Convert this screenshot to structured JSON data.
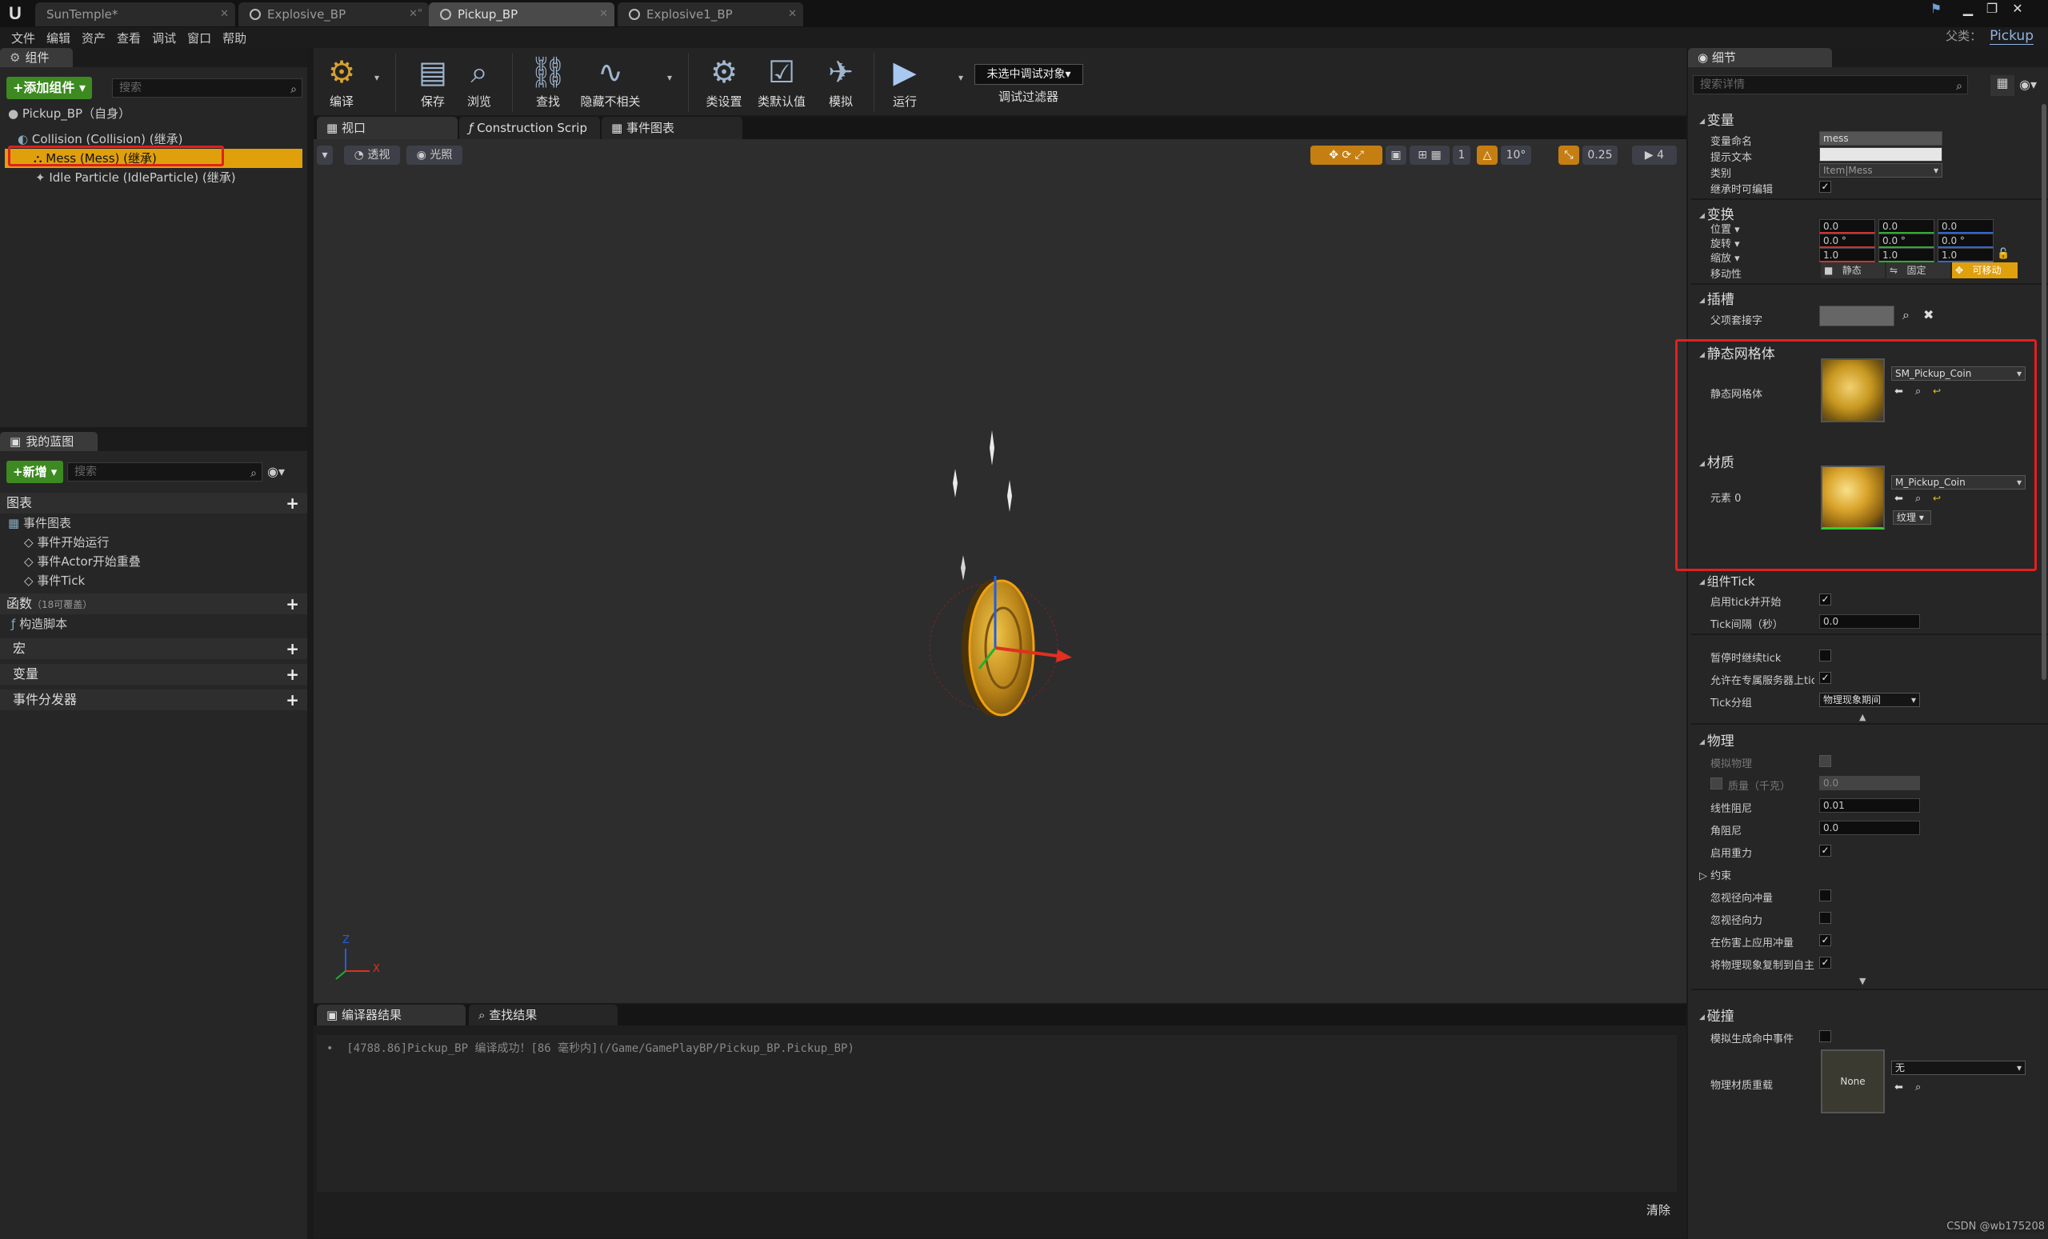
{
  "tabs": [
    {
      "label": "SunTemple*"
    },
    {
      "label": "Explosive_BP"
    },
    {
      "label": "Pickup_BP"
    },
    {
      "label": "Explosive1_BP"
    }
  ],
  "menu": [
    "文件",
    "编辑",
    "资产",
    "查看",
    "调试",
    "窗口",
    "帮助"
  ],
  "parent": {
    "label": "父类：",
    "value": "Pickup"
  },
  "components": {
    "tab": "组件",
    "add_button": "+添加组件 ▾",
    "search_placeholder": "搜索",
    "root": "Pickup_BP（自身）",
    "items": [
      "Collision (Collision) (继承)",
      "Mess (Mess) (继承)",
      "Idle Particle (IdleParticle) (继承)"
    ]
  },
  "myblueprint": {
    "tab": "我的蓝图",
    "new_button": "+新增 ▾",
    "search_placeholder": "搜索",
    "graphs": "图表",
    "event_graph": "事件图表",
    "events": [
      "事件开始运行",
      "事件Actor开始重叠",
      "事件Tick"
    ],
    "functions": "函数",
    "functions_count": "（18可覆盖）",
    "construction": "构造脚本",
    "macros": "宏",
    "variables": "变量",
    "dispatchers": "事件分发器"
  },
  "toolbar": {
    "compile": "编译",
    "save": "保存",
    "browse": "浏览",
    "find": "查找",
    "hide": "隐藏不相关",
    "class_settings": "类设置",
    "class_defaults": "类默认值",
    "simulate": "模拟",
    "play": "运行",
    "debug_object": "未选中调试对象▾",
    "debug_filter": "调试过滤器"
  },
  "viewtabs": [
    "视口",
    "Construction Scrip",
    "事件图表"
  ],
  "viewport": {
    "perspective": "透视",
    "lit": "光照",
    "angle": "10°",
    "scale": "0.25",
    "speed": "4",
    "axis_x": "X",
    "axis_z": "Z"
  },
  "bottom": {
    "tab1": "编译器结果",
    "tab2": "查找结果",
    "log": "[4788.86]Pickup_BP 编译成功！[86 毫秒内](/Game/GamePlayBP/Pickup_BP.Pickup_BP)",
    "clear": "清除"
  },
  "details": {
    "tab": "细节",
    "search_placeholder": "搜索详情",
    "variable": {
      "title": "变量",
      "name_label": "变量命名",
      "name_value": "mess",
      "tooltip_label": "提示文本",
      "category_label": "类别",
      "category_value": "Item|Mess",
      "editable_label": "继承时可编辑"
    },
    "transform": {
      "title": "变换",
      "location": "位置 ▾",
      "rotation": "旋转 ▾",
      "scale": "缩放 ▾",
      "mobility": "移动性",
      "loc": [
        "0.0",
        "0.0",
        "0.0"
      ],
      "rot": [
        "0.0 °",
        "0.0 °",
        "0.0 °"
      ],
      "scl": [
        "1.0",
        "1.0",
        "1.0"
      ],
      "static": "静态",
      "stationary": "固定",
      "movable": "可移动"
    },
    "sockets": {
      "title": "插槽",
      "parent_socket": "父项套接字"
    },
    "static_mesh": {
      "title": "静态网格体",
      "label": "静态网格体",
      "value": "SM_Pickup_Coin"
    },
    "materials": {
      "title": "材质",
      "label": "元素 0",
      "value": "M_Pickup_Coin",
      "texture": "纹理 ▾"
    },
    "tick": {
      "title": "组件Tick",
      "start": "启用tick并开始",
      "interval": "Tick间隔（秒）",
      "interval_value": "0.0",
      "pause": "暂停时继续tick",
      "dedicated": "允许在专属服务器上tick",
      "group": "Tick分组",
      "group_value": "物理现象期间"
    },
    "physics": {
      "title": "物理",
      "simulate": "模拟物理",
      "mass": "质量（千克）",
      "mass_value": "0.0",
      "linear": "线性阻尼",
      "linear_value": "0.01",
      "angular": "角阻尼",
      "angular_value": "0.0",
      "gravity": "启用重力",
      "constraints": "约束",
      "ignore_radial_impulse": "忽视径向冲量",
      "ignore_radial_force": "忽视径向力",
      "apply_impulse": "在伤害上应用冲量",
      "replicate": "将物理现象复制到自主"
    },
    "collision": {
      "title": "碰撞",
      "sim_hit": "模拟生成命中事件",
      "phys_mat": "物理材质重载",
      "none": "None",
      "phys_mat_value": "无"
    }
  },
  "watermark": "CSDN @wb175208"
}
